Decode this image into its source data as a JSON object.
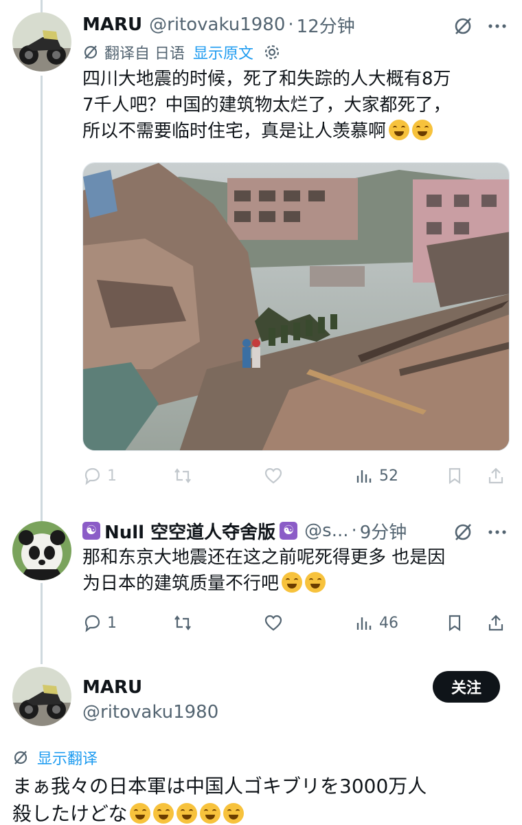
{
  "tweets": [
    {
      "name": "MARU",
      "handle": "@ritovaku1980",
      "separator": "·",
      "time": "12分钟",
      "translate_label": "翻译自 日语",
      "show_original": "显示原文",
      "text_lines": [
        "四川大地震的时候，死了和失踪的人大概有8万",
        "7千人吧？中国的建筑物太烂了，大家都死了，",
        "所以不需要临时住宅，真是让人羡慕啊"
      ],
      "emoji_count": 2,
      "stats": {
        "replies": "1",
        "views": "52"
      }
    },
    {
      "name": "Null 空空道人夺舍版",
      "handle": "@s...",
      "separator": "·",
      "time": "9分钟",
      "text_lines": [
        "那和东京大地震还在这之前呢死得更多 也是因",
        "为日本的建筑质量不行吧"
      ],
      "emoji_count": 2,
      "stats": {
        "replies": "1",
        "views": "46"
      }
    },
    {
      "name": "MARU",
      "handle": "@ritovaku1980",
      "follow_label": "关注",
      "translate_label": "显示翻译",
      "text_lines": [
        "まぁ我々の日本軍は中国人ゴキブリを3000万人",
        "殺したけどな"
      ],
      "emoji_count": 5
    }
  ],
  "icons": {
    "translate": "translate-icon",
    "settings": "gear-icon",
    "reply": "reply-icon",
    "repost": "repost-icon",
    "like": "heart-icon",
    "views": "views-icon",
    "bookmark": "bookmark-icon",
    "share": "share-icon",
    "more": "more-icon",
    "grok": "grok-icon"
  },
  "colors": {
    "link": "#1d9bf0",
    "secondary_text": "#536471",
    "follow_button": "#0f1419"
  }
}
